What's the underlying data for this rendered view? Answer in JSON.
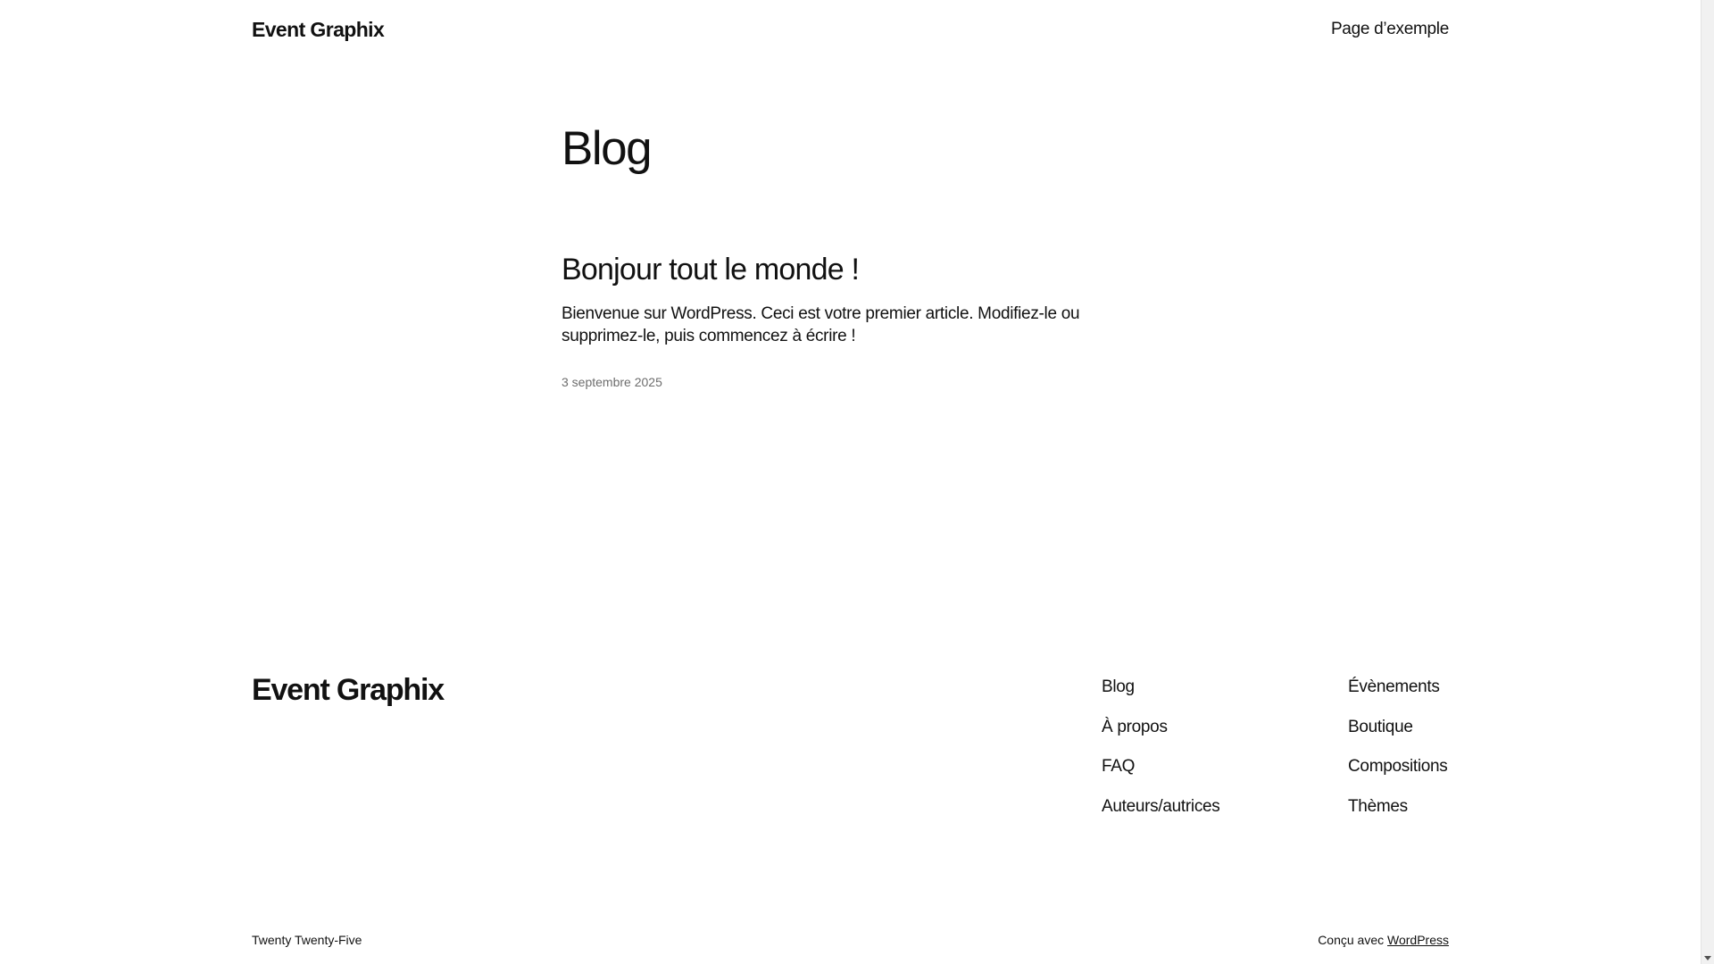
{
  "header": {
    "site_title": "Event Graphix",
    "nav_link": "Page d’exemple"
  },
  "main": {
    "heading": "Blog",
    "post": {
      "title": "Bonjour tout le monde !",
      "excerpt": "Bienvenue sur WordPress. Ceci est votre premier article. Modifiez-le ou supprimez-le, puis commencez à écrire !",
      "date": "3 septembre 2025"
    }
  },
  "footer": {
    "site_title": "Event Graphix",
    "column_1": [
      "Blog",
      "À propos",
      "FAQ",
      "Auteurs/autrices"
    ],
    "column_2": [
      "Évènements",
      "Boutique",
      "Compositions",
      "Thèmes"
    ],
    "credit": "Twenty Twenty-Five",
    "powered_prefix": "Conçu avec ",
    "powered_link": "WordPress"
  }
}
